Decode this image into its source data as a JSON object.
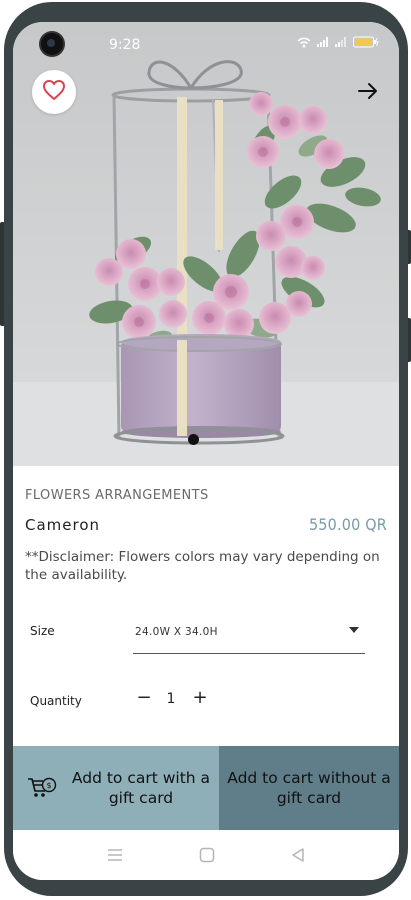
{
  "status_bar": {
    "time": "9:28",
    "icons": [
      "wifi-icon",
      "signal-icon",
      "signal-icon",
      "battery-icon"
    ]
  },
  "hero": {
    "favorite_icon": "heart-outline-icon",
    "next_icon": "arrow-right-icon",
    "image_subject": "pink roses arrangement in lilac pot with metal gift-box frame"
  },
  "product": {
    "category": "FLOWERS ARRANGEMENTS",
    "name": "Cameron",
    "price": "550.00 QR",
    "disclaimer": "**Disclaimer: Flowers colors may vary depending on the availability."
  },
  "options": {
    "size_label": "Size",
    "size_value": "24.0W X 34.0H",
    "quantity_label": "Quantity",
    "quantity_minus": "−",
    "quantity_value": "1",
    "quantity_plus": "+"
  },
  "actions": {
    "add_with_gift": "Add to cart with a gift card",
    "add_without_gift": "Add to cart without a gift card",
    "cart_icon": "cart-gift-icon"
  },
  "colors": {
    "price": "#7b9ba8",
    "btn_gift": "#8eaeb8",
    "btn_nogift": "#5f7e89",
    "heart": "#d9434e"
  },
  "nav_bar": {
    "icons": [
      "recents-icon",
      "home-icon",
      "back-icon"
    ]
  }
}
